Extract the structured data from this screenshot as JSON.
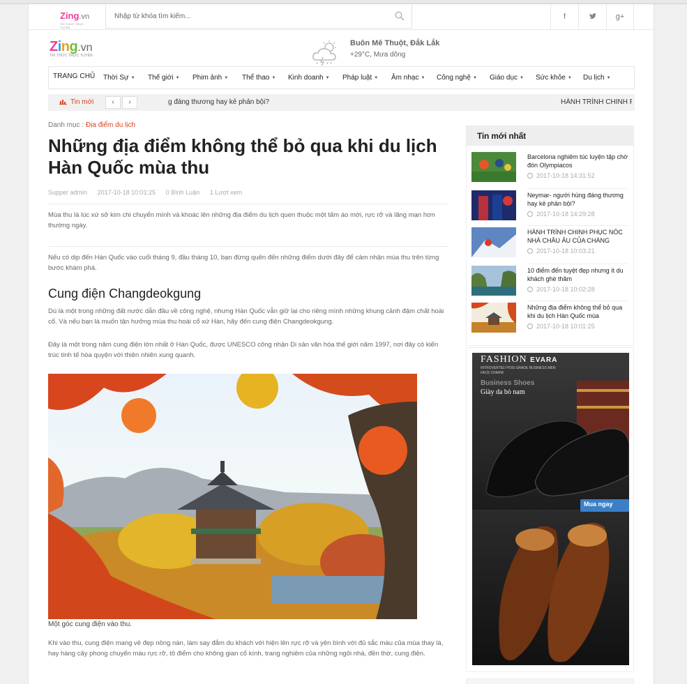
{
  "topbar": {
    "logo_text": "Zing",
    "logo_suffix": ".vn",
    "logo_tagline": "TRI THỨC TRỰC TUYẾN",
    "search_placeholder": "Nhập từ khóa tìm kiếm...",
    "social": [
      "f",
      "t",
      "g+"
    ]
  },
  "header": {
    "logo_letters": [
      "Z",
      "in",
      "g",
      ""
    ],
    "logo_suffix": ".vn",
    "logo_tagline": "TRI THỨC TRỰC TUYẾN",
    "weather_location": "Buôn Mê Thuột, Đắk Lắk",
    "weather_condition": "+29°C, Mưa dông"
  },
  "nav": {
    "home": "TRANG CHỦ",
    "items": [
      "Thời Sự",
      "Thế giới",
      "Phim ảnh",
      "Thể thao",
      "Kinh doanh",
      "Pháp luật",
      "Âm nhạc",
      "Công nghệ",
      "Giáo dục",
      "Sức khỏe",
      "Du lịch"
    ]
  },
  "ticker": {
    "label": "Tin mới",
    "prev": "‹",
    "next": "›",
    "text1": "g đáng thương hay kẻ phản bội?",
    "text2": "HÀNH TRÌNH CHINH PHỤC"
  },
  "article": {
    "category_prefix": "Danh mục :",
    "category": "Địa điểm du lịch",
    "title": "Những địa điểm không thể bỏ qua khi du lịch Hàn Quốc mùa thu",
    "author": "Supper admin",
    "date": "2017-10-18 10:01:25",
    "comments": "0 Bình Luận",
    "views": "1 Lượt xem",
    "p1": "Mùa thu là lúc xứ sở kim chi chuyển mình và khoác lên những địa điểm du lịch quen thuộc một tấm áo mới, rực rỡ và lãng mạn hơn thường ngày.",
    "p2": "Nếu có dịp đến Hàn Quốc vào cuối tháng 9, đầu tháng 10, bạn đừng quên đến những điểm dưới đây để cảm nhận mùa thu trên từng bước khám phá.",
    "subhead": "Cung điện Changdeokgung",
    "p3": "Dù là một trong những đất nước dẫn đầu về công nghệ, nhưng Hàn Quốc vẫn giữ lại cho riêng mình những khung cảnh đậm chất hoài cổ. Và nếu bạn là muốn tận hưởng mùa thu hoài cổ xứ Hàn, hãy đến cung điện Changdeokgung.",
    "p4": "Đây là một trong năm cung điện lớn nhất ở Hàn Quốc, được UNESCO công nhận Di sản văn hóa thế giới năm 1997, nơi đây có kiến trúc tinh tế hòa quyện với thiên nhiên xung quanh.",
    "caption": "Một góc cung điện vào thu.",
    "p5": "Khi vào thu, cung điện mang vẻ đẹp nồng nàn, làm say đắm du khách với hiện lên rực rỡ và yên bình với đủ sắc màu của mùa thay lá, hay hàng cây phong chuyển màu rực rỡ, tô điểm cho không gian cổ kính, trang nghiêm của những ngôi nhà, đền thờ, cung điện."
  },
  "sidebar": {
    "heading": "Tin mới nhất",
    "items": [
      {
        "title": "Barcelona nghiêm túc luyện tập chờ đón Olympiacos",
        "date": "2017-10-18 14:31:52"
      },
      {
        "title": "Neymar- người hùng đáng thương hay kẻ phản bội?",
        "date": "2017-10-18 14:29:28"
      },
      {
        "title": "HÀNH TRÌNH CHINH PHỤC NÓC NHÀ CHÂU ÂU CỦA CHÀNG",
        "date": "2017-10-18 10:03:21"
      },
      {
        "title": "10 điểm đến tuyệt đẹp nhưng ít du khách ghé thăm",
        "date": "2017-10-18 10:02:28"
      },
      {
        "title": "Những địa điểm không thể bỏ qua khi du lịch Hàn Quốc mùa",
        "date": "2017-10-18 10:01:25"
      }
    ]
  },
  "ad": {
    "brand": "FASHION",
    "brand2": "EVARA",
    "tagline": "INTROVERTED POIS GRADE BUSINESS MEN FACE CHARM",
    "product": "Business Shoes",
    "product_vi": "Giày da bò nam",
    "cta": "Mua ngay"
  },
  "colors": {
    "accent": "#d9401f",
    "nav_bg": "#ffffff",
    "ticker_bg": "#f1f1f1"
  }
}
